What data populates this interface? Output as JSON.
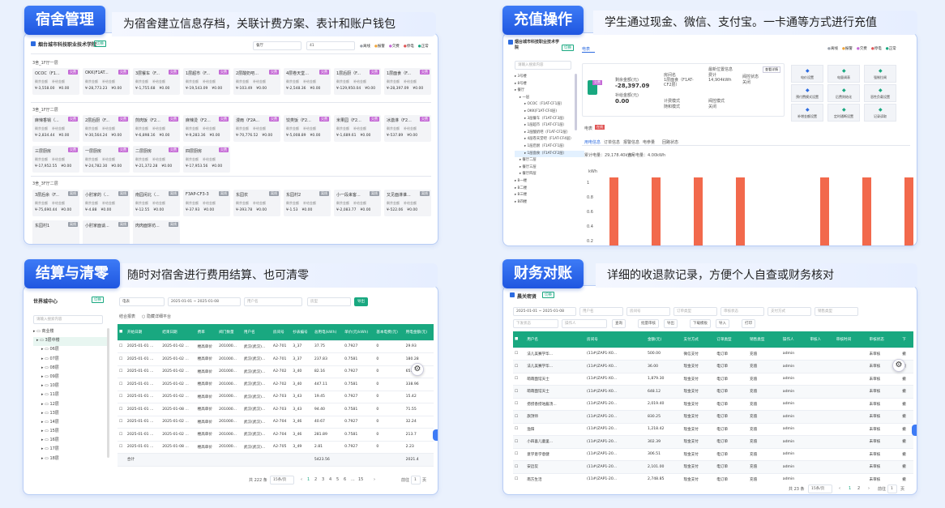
{
  "p1": {
    "tag": "宿舍管理",
    "banner": "为宿舍建立信息存档，关联计费方案、表计和账户钱包",
    "school": "烟台城市科技职业技术学院",
    "switch": "切换",
    "sel1": "餐厅",
    "sel2": "41",
    "legend": [
      "离线",
      "报警",
      "欠费",
      "停电",
      "正常"
    ],
    "s1_title": "3舍_1F厅一层",
    "s2_title": "3舍_1F厅二层",
    "s3_title": "3舍_3F厅二层",
    "label_balance": "剩余金额",
    "label_remain": "补给金额",
    "row1": [
      {
        "n": "OCOC（F1...",
        "b": "欠费",
        "v": "¥-3,558.00",
        "r": "¥0.00"
      },
      {
        "n": "OKK(F1AT...",
        "b": "欠费",
        "v": "¥-28,773.23",
        "r": "¥0.00"
      },
      {
        "n": "3层餐车（F...",
        "b": "欠费",
        "v": "¥-1,755.68",
        "r": "¥0.00"
      },
      {
        "n": "1层超市（F...",
        "b": "欠费",
        "v": "¥-19,543.09",
        "r": "¥0.00"
      },
      {
        "n": "2层酸奶吧...",
        "b": "欠费",
        "v": "¥-103.49",
        "r": "¥0.00"
      },
      {
        "n": "4层卷天堂...",
        "b": "欠费",
        "v": "¥-2,548.36",
        "r": "¥0.00"
      },
      {
        "n": "1层后厨（F...",
        "b": "欠费",
        "v": "¥-129,950.04",
        "r": "¥0.00"
      },
      {
        "n": "1层面食（F...",
        "b": "欠费",
        "v": "¥-28,397.09",
        "r": "¥0.00"
      }
    ],
    "row2": [
      {
        "n": "麻辣香锅（...",
        "b": "欠费",
        "v": "¥-2,834.44",
        "r": "¥0.00"
      },
      {
        "n": "2层后厨（F...",
        "b": "欠费",
        "v": "¥-30,564.24",
        "r": "¥0.00"
      },
      {
        "n": "煎肉饭（F2...",
        "b": "欠费",
        "v": "¥-6,898.16",
        "r": "¥0.00"
      },
      {
        "n": "麻辣烫（F2...",
        "b": "欠费",
        "v": "¥-9,283.36",
        "r": "¥0.00"
      },
      {
        "n": "漫雨（F2A...",
        "b": "欠费",
        "v": "¥-70,776.52",
        "r": "¥0.00"
      },
      {
        "n": "饺类饭（F2...",
        "b": "欠费",
        "v": "¥-5,008.89",
        "r": "¥0.00"
      },
      {
        "n": "米果园（F2...",
        "b": "欠费",
        "v": "¥-1,689.61",
        "r": "¥0.00"
      },
      {
        "n": "冰激淋（F2...",
        "b": "欠费",
        "v": "¥-537.89",
        "r": "¥0.00"
      }
    ],
    "row3": [
      {
        "n": "三层厨房",
        "b": "欠费",
        "v": "¥-17,952.55",
        "r": "¥0.00"
      },
      {
        "n": "一层厨房",
        "b": "欠费",
        "v": "¥-24,782.30",
        "r": "¥0.00"
      },
      {
        "n": "二层厨房",
        "b": "欠费",
        "v": "¥-21,372.28",
        "r": "¥0.00"
      },
      {
        "n": "四层厨房",
        "b": "欠费",
        "v": "¥-17,953.56",
        "r": "¥0.00"
      }
    ],
    "row4": [
      {
        "n": "3层后余（F...",
        "b": "离线",
        "v": "¥-75,690.44",
        "r": "¥0.00"
      },
      {
        "n": "小肘家的（...",
        "b": "离线",
        "v": "¥-4.88",
        "r": "¥0.00"
      },
      {
        "n": "南园闲北（...",
        "b": "离线",
        "v": "¥-12.55",
        "r": "¥0.00"
      },
      {
        "n": "F3AP-CF3-3",
        "b": "离线",
        "v": "¥-37.93",
        "r": "¥0.00"
      },
      {
        "n": "东园农",
        "b": "离线",
        "v": "¥-393.78",
        "r": "¥0.00"
      },
      {
        "n": "东园村2",
        "b": "离线",
        "v": "¥-1.53",
        "r": "¥0.00"
      },
      {
        "n": "小一段来客...",
        "b": "离线",
        "v": "¥-2,083.77",
        "r": "¥0.00"
      },
      {
        "n": "又见面淋谁...",
        "b": "离线",
        "v": "¥-522.06",
        "r": "¥0.00"
      }
    ],
    "row5": [
      {
        "n": "东园村1",
        "b": "离线",
        "v": "",
        "r": ""
      },
      {
        "n": "小肘家面谈...",
        "b": "离线",
        "v": "",
        "r": ""
      },
      {
        "n": "肉肉面饼坊...",
        "b": "离线",
        "v": "",
        "r": ""
      }
    ]
  },
  "p2": {
    "tag": "充值操作",
    "banner": "学生通过现金、微信、支付宝。一卡通等方式进行充值",
    "school": "烟台城市科技职业技术学院",
    "switch": "切换",
    "tab": "电表",
    "search_ph": "请输入搜索内容",
    "legend": [
      "离线",
      "报警",
      "欠费",
      "停电",
      "正常"
    ],
    "tree": [
      "3号楼",
      "8号楼",
      "餐厅",
      "一层",
      "OCOC（F1AT-CF1层）",
      "OKK(F1AT-CF4层)",
      "3层餐车（F1AT-CF3层）",
      "1层超市（F1AT-CF1层）",
      "2层酸奶吧（F1AT-CF2层）",
      "4层卷天堂吧（F1AT-CF4层）",
      "1层后厨（F1AT-CF1层）",
      "1层面食（F1AT-CF2层）",
      "餐厅二层",
      "餐厅三层",
      "餐厅四层",
      "B一楼",
      "B二楼",
      "B三楼",
      "B四楼"
    ],
    "meter_badge": "欠费",
    "balance_label": "剩余金额(元)",
    "balance": "-28,397.09",
    "subsidy_label": "补给金额(元)",
    "subsidy": "0.00",
    "stat_title": "最新位置信息",
    "f1k": "房间名",
    "f1v": "1层面食（F1AT-CF2层）",
    "f2k": "费计",
    "f2v": "14,904kWh",
    "f3k": "阀控状态",
    "f3v": "关闭",
    "f4k": "计费模式",
    "f4v": "随和模式",
    "f5k": "阀控模式",
    "f5v": "关闭",
    "detail": "查看详情",
    "ops": [
      "电价设置",
      "电量调表",
      "强制拉闸",
      "预付费模式设置",
      "后费则结化",
      "恶性负载设置",
      "补增金额设置",
      "定时通断设置",
      "记录读取"
    ],
    "tabs2": [
      "用电信息",
      "订单信息",
      "报警信息",
      "电参量",
      "回路状态"
    ],
    "today_label": "累计电量：29,178.40kWh",
    "month_label": "当月电量：4.00kWh",
    "chart_unit": "kWh",
    "yticks": [
      "1",
      "0.8",
      "0.6",
      "0.4",
      "0.2"
    ],
    "row_label": "电表",
    "row_badge": "在线"
  },
  "p3": {
    "tag": "结算与清零",
    "banner": "随时对宿舍进行费用结算、也可清零",
    "title": "世界城中心",
    "switch": "切换",
    "search_ph": "请输入搜索内容",
    "tree": [
      "商业楼",
      "3层中楼",
      "06层",
      "07层",
      "08层",
      "09层",
      "10层",
      "11层",
      "12层",
      "13层",
      "14层",
      "15层",
      "16层",
      "17层",
      "18层"
    ],
    "f_type": "电表",
    "f_date1": "2025-01-01",
    "f_date2": "2025-01-08",
    "f_user": "用户名",
    "f_sel": "房型",
    "f_btn": "导出",
    "opt1": "结合报表",
    "opt2": "隐藏详细平台",
    "headers": [
      "开始日期",
      "结束日期",
      "费率",
      "阀门数量",
      "用户名",
      "房间号",
      "抄表编号",
      "总用电(kWh)",
      "单价(元/kWh)",
      "基本电费(元)",
      "用电金额(元)"
    ],
    "rows": [
      [
        "2025-01-01 ...",
        "2025-01-02 ...",
        "楼高单价",
        "201000...",
        "武汉(武汉)...",
        "A2-701",
        "3_37",
        "37.75",
        "0.7927",
        "0",
        "29.93"
      ],
      [
        "2025-01-01 ...",
        "2025-01-02 ...",
        "楼高单价",
        "201000...",
        "武汉(武汉)...",
        "A2-701",
        "3_37",
        "237.83",
        "0.7581",
        "0",
        "180.28"
      ],
      [
        "2025-01-01 ...",
        "2025-01-02 ...",
        "楼高单价",
        "201000...",
        "武汉(武汉)...",
        "A2-702",
        "3_40",
        "82.16",
        "0.7927",
        "0",
        "65.13"
      ],
      [
        "2025-01-01 ...",
        "2025-01-02 ...",
        "楼高单价",
        "201000...",
        "武汉(武汉)...",
        "A2-702",
        "3_40",
        "447.11",
        "0.7581",
        "0",
        "338.96"
      ],
      [
        "2025-01-01 ...",
        "2025-01-02 ...",
        "楼高单价",
        "201000...",
        "武汉(武汉)...",
        "A2-703",
        "3_43",
        "19.45",
        "0.7927",
        "0",
        "15.42"
      ],
      [
        "2025-01-01 ...",
        "2025-01-08 ...",
        "楼高单价",
        "201000...",
        "武汉(武汉)...",
        "A2-703",
        "3_43",
        "94.40",
        "0.7581",
        "0",
        "71.55"
      ],
      [
        "2025-01-01 ...",
        "2025-01-02 ...",
        "楼高单价",
        "201000...",
        "武汉(武汉)...",
        "A2-704",
        "3_46",
        "40.67",
        "0.7927",
        "0",
        "32.24"
      ],
      [
        "2025-01-01 ...",
        "2025-01-02 ...",
        "楼高单价",
        "201000...",
        "武汉(武汉)...",
        "A2-704",
        "3_46",
        "281.89",
        "0.7581",
        "0",
        "213.7"
      ],
      [
        "2025-01-01 ...",
        "2025-01-08 ...",
        "楼高单价",
        "201000...",
        "武汉(武汉)...",
        "A2-705",
        "3_49",
        "2.81",
        "0.7927",
        "0",
        "2.23"
      ]
    ],
    "total_label": "合计",
    "total_kwh": "5423.56",
    "total_amt": "2021.4",
    "page_total": "共 222 条",
    "page_size": "15条/页",
    "pages": [
      "1",
      "2",
      "3",
      "4",
      "5",
      "6",
      "...",
      "15"
    ],
    "goto": "前往",
    "goto_val": "1",
    "goto_unit": "页"
  },
  "p4": {
    "tag": "财务对账",
    "banner": "详细的收退款记录，方便个人自查或财务核对",
    "title": "晨关密贤",
    "switch": "切换",
    "f_date1": "2025-01-01",
    "f_date2": "2025-01-08",
    "filters1": [
      "用户名",
      "房间号",
      "订单类型",
      "审核状态",
      "支付方式",
      "销售类型"
    ],
    "filters2": [
      "下发状态",
      "操作人"
    ],
    "btns": [
      "查询",
      "批量审核",
      "导出",
      "下载模板",
      "导入",
      "打印"
    ],
    "headers": [
      "用户名",
      "房间号",
      "金额(元)",
      "支付方式",
      "订单类型",
      "销售类型",
      "操作人",
      "审核人",
      "审核时间",
      "审核状态",
      "下"
    ],
    "rows": [
      [
        "法儿美赛学华...",
        "(11#)ZAP1-X0...",
        "500.00",
        "微信支付",
        "电订单",
        "充值",
        "admin",
        "",
        "",
        "未审核",
        "撤"
      ],
      [
        "法儿美赛学华...",
        "(11#)ZAP1-X0...",
        "36.00",
        "现金支付",
        "电订单",
        "充值",
        "admin",
        "",
        "",
        "未审核",
        "撤"
      ],
      [
        "萌萌面馆天士",
        "(11#)ZAP1-X0...",
        "1,879.30",
        "现金支付",
        "电订单",
        "充值",
        "admin",
        "",
        "",
        "未审核",
        "撤"
      ],
      [
        "萌萌面馆天士",
        "(11#)ZAP1-X0...",
        "648.12",
        "现金支付",
        "电订单",
        "充值",
        "admin",
        "",
        "",
        "未审核",
        "撤"
      ],
      [
        "捞捞香捞咕酱汤...",
        "(11#)ZAP1-20...",
        "2,019.40",
        "现金支付",
        "电订单",
        "充值",
        "admin",
        "",
        "",
        "未审核",
        "撤"
      ],
      [
        "旗顶师",
        "(11#)ZAP1-20...",
        "830.25",
        "现金支付",
        "电订单",
        "充值",
        "admin",
        "",
        "",
        "未审核",
        "撤"
      ],
      [
        "渔阳",
        "(11#)ZAP1-20...",
        "1,218.42",
        "现金支付",
        "电订单",
        "充值",
        "admin",
        "",
        "",
        "未审核",
        "撤"
      ],
      [
        "小四喜儿童里...",
        "(11#)ZAP1-20...",
        "302.39",
        "现金支付",
        "电订单",
        "充值",
        "admin",
        "",
        "",
        "未审核",
        "撤"
      ],
      [
        "意学意学意健",
        "(11#)ZAP1-20...",
        "306.51",
        "现金支付",
        "电订单",
        "充值",
        "admin",
        "",
        "",
        "未审核",
        "撤"
      ],
      [
        "安迈炭",
        "(11#)ZAP1-20...",
        "2,101.00",
        "现金支付",
        "电订单",
        "充值",
        "admin",
        "",
        "",
        "未审核",
        "撤"
      ],
      [
        "南方生活",
        "(11#)ZAP1-20...",
        "2,748.85",
        "现金支付",
        "电订单",
        "充值",
        "admin",
        "",
        "",
        "未审核",
        "撤"
      ]
    ],
    "page_total": "共 23 条",
    "page_size": "15条/页",
    "pages": [
      "1",
      "2"
    ],
    "goto": "前往",
    "goto_val": "1",
    "goto_unit": "页"
  }
}
